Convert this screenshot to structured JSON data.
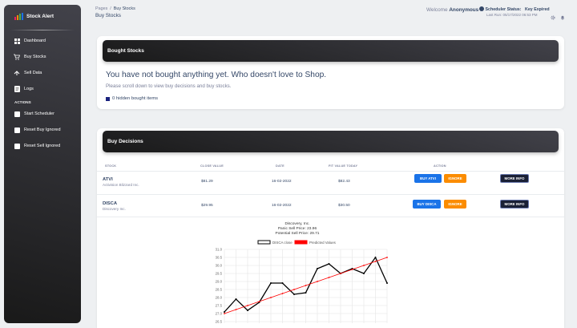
{
  "sidebar": {
    "brand": "Stock Alert",
    "items": [
      {
        "label": "Dashboard",
        "icon": "dashboard-icon"
      },
      {
        "label": "Buy Stocks",
        "icon": "cart-icon"
      },
      {
        "label": "Sell Data",
        "icon": "sell-icon"
      },
      {
        "label": "Logs",
        "icon": "logs-icon"
      }
    ],
    "section_label": "ACTIONS",
    "actions": [
      {
        "label": "Start Scheduler",
        "icon": "square-icon"
      },
      {
        "label": "Reset Buy Ignored",
        "icon": "square-icon"
      },
      {
        "label": "Reset Sell Ignored",
        "icon": "square-icon"
      }
    ]
  },
  "header": {
    "breadcrumb": [
      "Pages",
      "/",
      "Buy Stocks"
    ],
    "title": "Buy Stocks",
    "welcome_label": "Welcome",
    "user": "Anonymous",
    "scheduler_label": "Scheduler Status:",
    "scheduler_value": "Key Expired",
    "last_run": "Last Run: 05/17/2022 06:53 PM"
  },
  "bought": {
    "title": "Bought Stocks",
    "empty_message": "You have not bought anything yet. Who doesn't love to Shop.",
    "hint": "Please scroll down to view buy decisions and buy stocks.",
    "hidden": "0 hidden bought items"
  },
  "decisions": {
    "title": "Buy Decisions",
    "columns": [
      "STOCK",
      "CLOSE VALUE",
      "DATE",
      "FIT VALUE TODAY",
      "ACTION"
    ],
    "rows": [
      {
        "symbol": "ATVI",
        "name": "Activision Blizzard Inc.",
        "close": "$81.29",
        "date": "16-02-2022",
        "fit": "$82.43",
        "buy_label": "BUY ATVI",
        "ignore_label": "IGNORE",
        "more_label": "MORE INFO"
      },
      {
        "symbol": "DISCA",
        "name": "Discovery Inc.",
        "close": "$29.95",
        "date": "16-02-2022",
        "fit": "$30.50",
        "buy_label": "BUY DISCA",
        "ignore_label": "IGNORE",
        "more_label": "MORE INFO"
      }
    ]
  },
  "chart_data": {
    "type": "line",
    "title_lines": [
      "Discovery, Inc.",
      "Panic Sell Price: 23.96",
      "Potential Sell Price: 29.71"
    ],
    "series": [
      {
        "name": "DISCA close",
        "color": "#000000",
        "values": [
          27.1,
          27.9,
          27.2,
          27.7,
          28.9,
          28.9,
          28.2,
          28.3,
          29.8,
          30.1,
          29.5,
          29.8,
          29.5,
          30.5,
          28.9
        ]
      },
      {
        "name": "Predicted Values",
        "color": "#ff0000",
        "values": [
          27.0,
          27.25,
          27.5,
          27.75,
          28.0,
          28.25,
          28.5,
          28.75,
          29.0,
          29.25,
          29.5,
          29.75,
          30.0,
          30.25,
          30.5
        ]
      }
    ],
    "yticks": [
      "31.0",
      "30.5",
      "30.0",
      "29.5",
      "29.0",
      "28.5",
      "28.0",
      "27.5",
      "27.0",
      "26.5"
    ],
    "ylim": [
      26.5,
      31.0
    ]
  }
}
